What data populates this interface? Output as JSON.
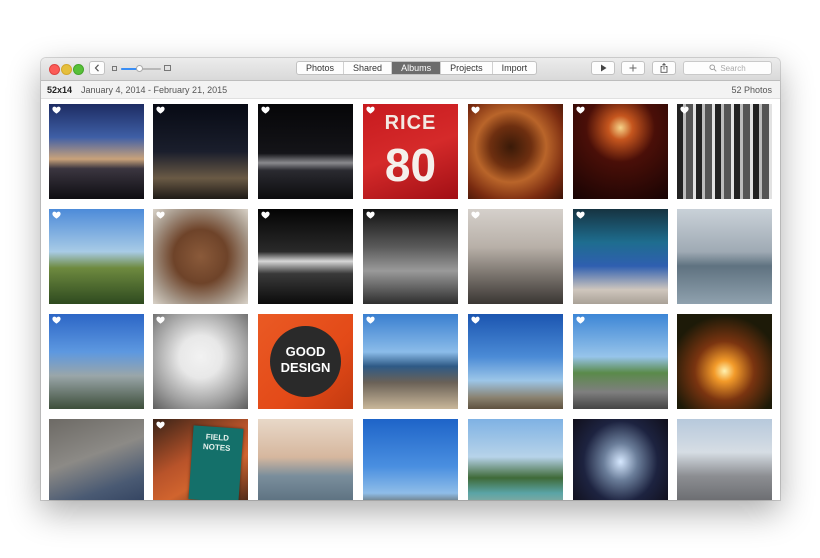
{
  "toolbar": {
    "tabs": [
      {
        "label": "Photos"
      },
      {
        "label": "Shared"
      },
      {
        "label": "Albums",
        "active": true
      },
      {
        "label": "Projects"
      },
      {
        "label": "Import"
      }
    ],
    "search_placeholder": "Search",
    "zoom_level": 0.45,
    "buttons": [
      "back",
      "slideshow",
      "add",
      "share"
    ]
  },
  "album": {
    "title": "52x14",
    "dates": "January 4, 2014 - February 21, 2015",
    "count": "52 Photos"
  },
  "colors": {
    "active_tab": "#6c6c6c",
    "close": "#fc5b57",
    "minimize": "#e5bf3c",
    "maximize": "#57c038",
    "slider_accent": "#3a8ef5"
  },
  "photos": [
    {
      "subject": "night sky over horizon",
      "favorite": true
    },
    {
      "subject": "city skyline at night",
      "favorite": true
    },
    {
      "subject": "bridge lit at night",
      "favorite": true
    },
    {
      "subject": "red football jersey",
      "favorite": true,
      "caption": "RICE",
      "number": "80"
    },
    {
      "subject": "cup of tea",
      "favorite": true
    },
    {
      "subject": "two red candles",
      "favorite": true
    },
    {
      "subject": "striped textiles",
      "favorite": true
    },
    {
      "subject": "trees and sky",
      "favorite": true
    },
    {
      "subject": "knit blanket",
      "favorite": true
    },
    {
      "subject": "theater marquee at night",
      "favorite": true
    },
    {
      "subject": "alley at night",
      "favorite": true
    },
    {
      "subject": "foggy city street",
      "favorite": true
    },
    {
      "subject": "speaker on stage",
      "favorite": true
    },
    {
      "subject": "calm water under clouds",
      "favorite": false
    },
    {
      "subject": "downtown towers",
      "favorite": true
    },
    {
      "subject": "framed poster on wall",
      "favorite": true
    },
    {
      "subject": "good design sign",
      "favorite": false,
      "caption": "GOOD DESIGN"
    },
    {
      "subject": "rocky beach",
      "favorite": true
    },
    {
      "subject": "blue sky over sand",
      "favorite": true
    },
    {
      "subject": "coastal highway",
      "favorite": true
    },
    {
      "subject": "sunset through trees",
      "favorite": false
    },
    {
      "subject": "blue notebook on table",
      "favorite": false
    },
    {
      "subject": "field notes notebooks",
      "favorite": true,
      "caption": "FIELD NOTES"
    },
    {
      "subject": "sunset over bay",
      "favorite": false
    },
    {
      "subject": "clear sky over hills",
      "favorite": false
    },
    {
      "subject": "vintage car and tree",
      "favorite": false
    },
    {
      "subject": "city street at night",
      "favorite": false
    },
    {
      "subject": "city skyline aerial",
      "favorite": false
    }
  ]
}
